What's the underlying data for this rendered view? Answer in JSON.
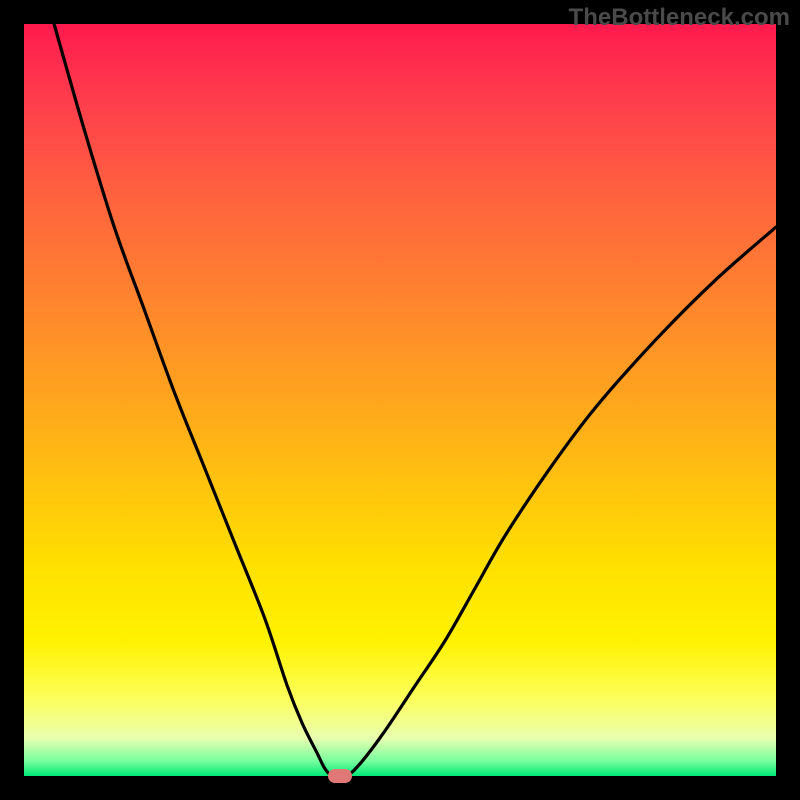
{
  "watermark": "TheBottleneck.com",
  "colors": {
    "frame": "#000000",
    "gradient_top": "#ff1a4d",
    "gradient_bottom": "#00e878",
    "curve": "#000000",
    "marker": "#e07878"
  },
  "chart_data": {
    "type": "line",
    "title": "",
    "xlabel": "",
    "ylabel": "",
    "xlim": [
      0,
      100
    ],
    "ylim": [
      0,
      100
    ],
    "legend": false,
    "grid": false,
    "series": [
      {
        "name": "bottleneck-curve",
        "x": [
          4,
          8,
          12,
          16,
          20,
          24,
          28,
          32,
          35,
          37,
          39,
          40,
          41,
          42,
          43,
          45,
          48,
          52,
          56,
          60,
          64,
          70,
          76,
          84,
          92,
          100
        ],
        "y": [
          100,
          86,
          73,
          62,
          51,
          41,
          31,
          21,
          12,
          7,
          3,
          1,
          0,
          0,
          0,
          2,
          6,
          12,
          18,
          25,
          32,
          41,
          49,
          58,
          66,
          73
        ]
      }
    ],
    "marker": {
      "x": 42,
      "y": 0
    }
  }
}
